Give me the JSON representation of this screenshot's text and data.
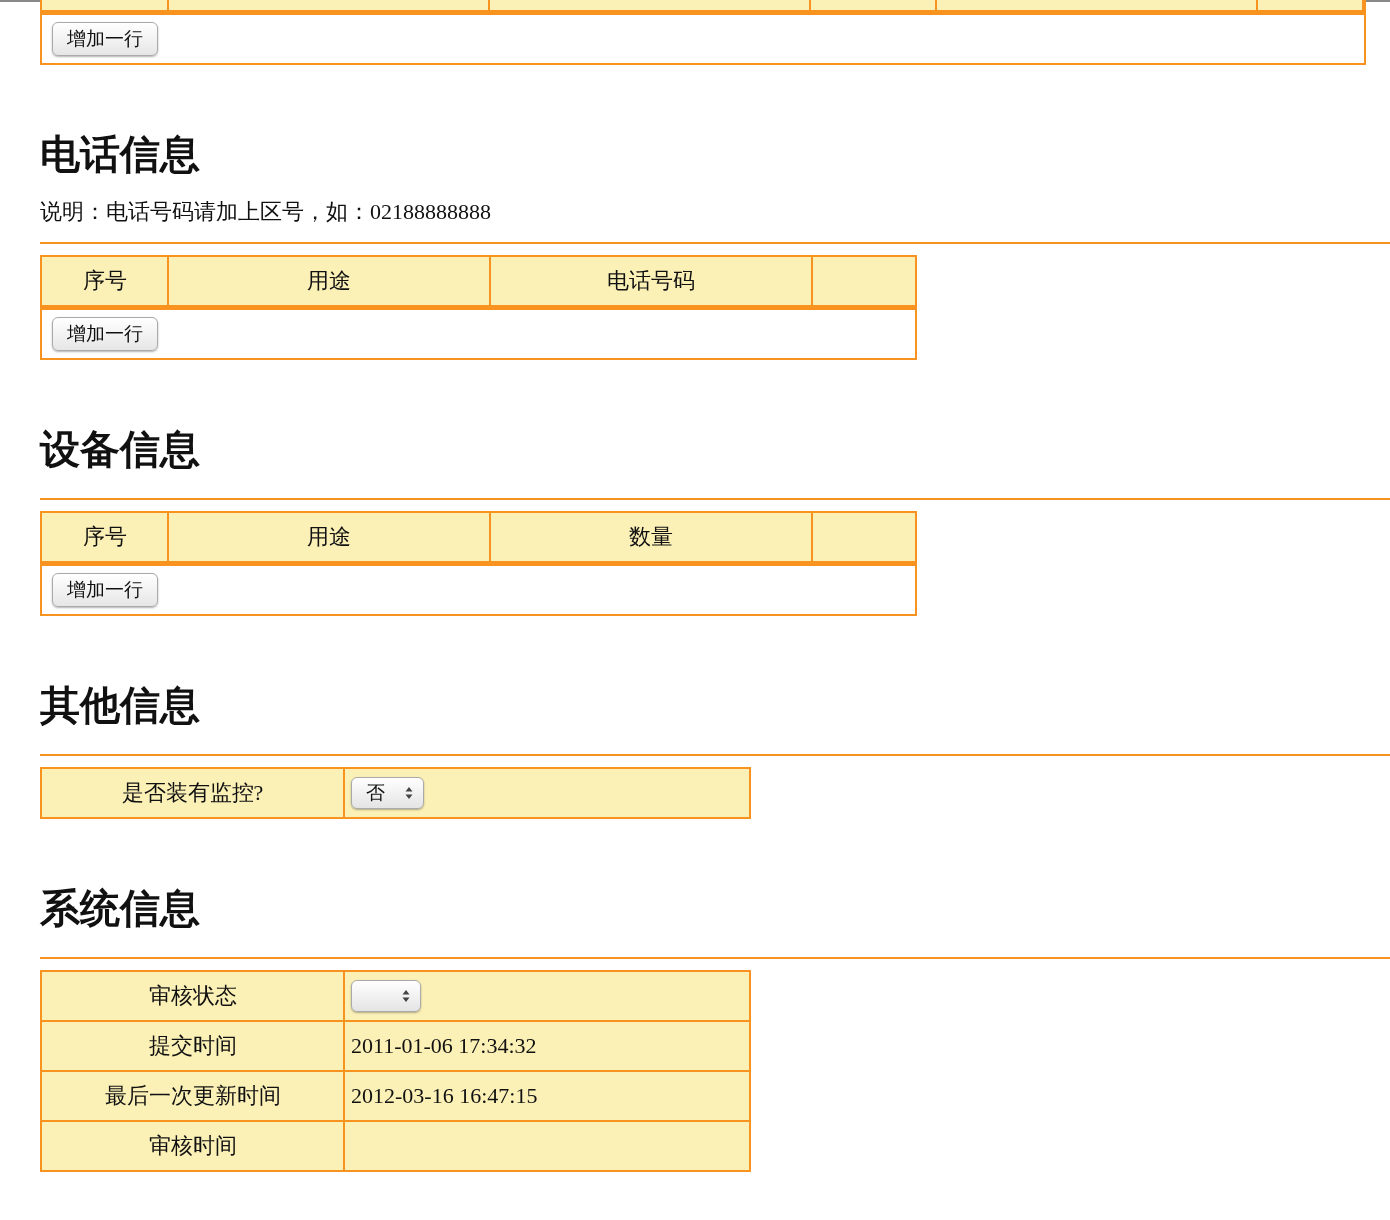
{
  "top_table": {
    "add_button": "增加一行"
  },
  "sections": [
    {
      "title": "电话信息",
      "note": "说明：电话号码请加上区号，如：02188888888",
      "kind": "list",
      "columns": [
        "序号",
        "用途",
        "电话号码"
      ],
      "add_button": "增加一行"
    },
    {
      "title": "设备信息",
      "kind": "list",
      "columns": [
        "序号",
        "用途",
        "数量"
      ],
      "add_button": "增加一行"
    },
    {
      "title": "其他信息",
      "kind": "form",
      "rows": [
        {
          "label": "是否装有监控?",
          "kind": "select",
          "value": "否"
        }
      ]
    },
    {
      "title": "系统信息",
      "kind": "form",
      "rows": [
        {
          "label": "审核状态",
          "kind": "select"
        },
        {
          "label": "提交时间",
          "kind": "text",
          "value": "2011-01-06 17:34:32"
        },
        {
          "label": "最后一次更新时间",
          "kind": "text",
          "value": "2012-03-16 16:47:15"
        },
        {
          "label": "审核时间",
          "kind": "text"
        }
      ]
    }
  ]
}
